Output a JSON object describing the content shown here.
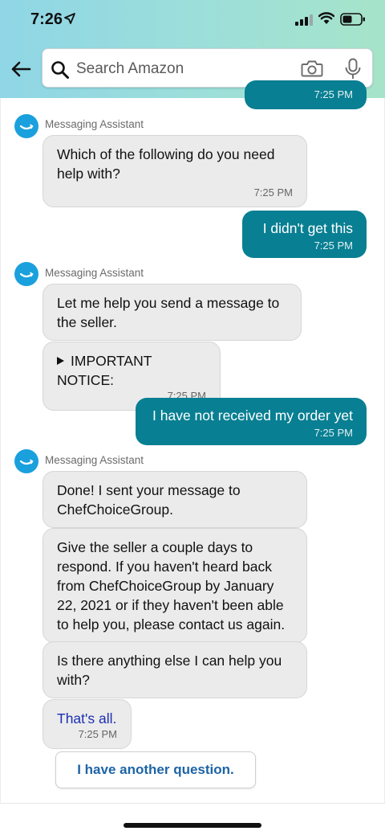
{
  "status_bar": {
    "time": "7:26"
  },
  "search": {
    "placeholder": "Search Amazon"
  },
  "colors": {
    "user_bubble": "#087f92",
    "bot_bubble": "#ebebeb",
    "avatar": "#1aa0dd",
    "link": "#1c2fb3",
    "question_button_text": "#1d64a5"
  },
  "icons": {
    "location": "location-arrow-icon",
    "signal": "signal-icon",
    "wifi": "wifi-icon",
    "battery": "battery-icon",
    "back": "back-arrow-icon",
    "search": "search-icon",
    "camera": "camera-icon",
    "microphone": "mic-icon",
    "triangle": "disclosure-triangle-icon",
    "avatar": "amazon-smile-icon"
  },
  "conversation": {
    "partial_top_timestamp": "7:25 PM",
    "group1": {
      "sender": "Messaging Assistant",
      "message1": {
        "text": "Which of the following do you need help with?",
        "time": "7:25 PM"
      }
    },
    "user1": {
      "text": "I didn't get this",
      "time": "7:25 PM"
    },
    "group2": {
      "sender": "Messaging Assistant",
      "message1": {
        "text": "Let me help you send a message to the seller."
      },
      "message2": {
        "text": "IMPORTANT NOTICE:",
        "time": "7:25 PM"
      }
    },
    "user2": {
      "text": "I have not received my order yet",
      "time": "7:25 PM"
    },
    "group3": {
      "sender": "Messaging Assistant",
      "message1": {
        "text": "Done! I sent your message to ChefChoiceGroup."
      },
      "message2": {
        "text": "Give the seller a couple days to respond. If you haven't heard back from ChefChoiceGroup by January 22, 2021 or if they haven't been able to help you, please contact us again."
      },
      "message3": {
        "text": "Is there anything else I can help you with?"
      },
      "message4": {
        "text": "That's all.",
        "time": "7:25 PM"
      }
    },
    "question_button": "I have another question."
  }
}
